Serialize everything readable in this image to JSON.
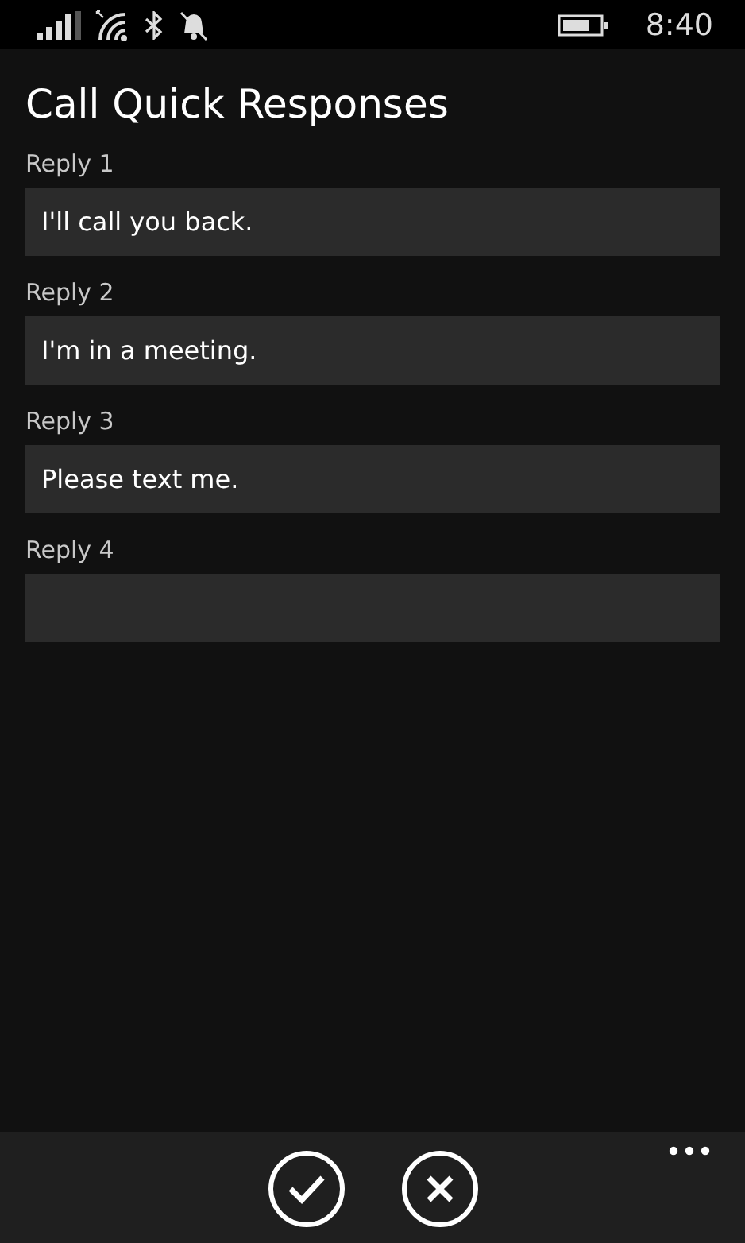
{
  "status_bar": {
    "time": "8:40"
  },
  "title": "Call Quick Responses",
  "replies": [
    {
      "label": "Reply 1",
      "value": "I'll call you back."
    },
    {
      "label": "Reply 2",
      "value": "I'm in a meeting."
    },
    {
      "label": "Reply 3",
      "value": "Please text me."
    },
    {
      "label": "Reply 4"
    }
  ]
}
